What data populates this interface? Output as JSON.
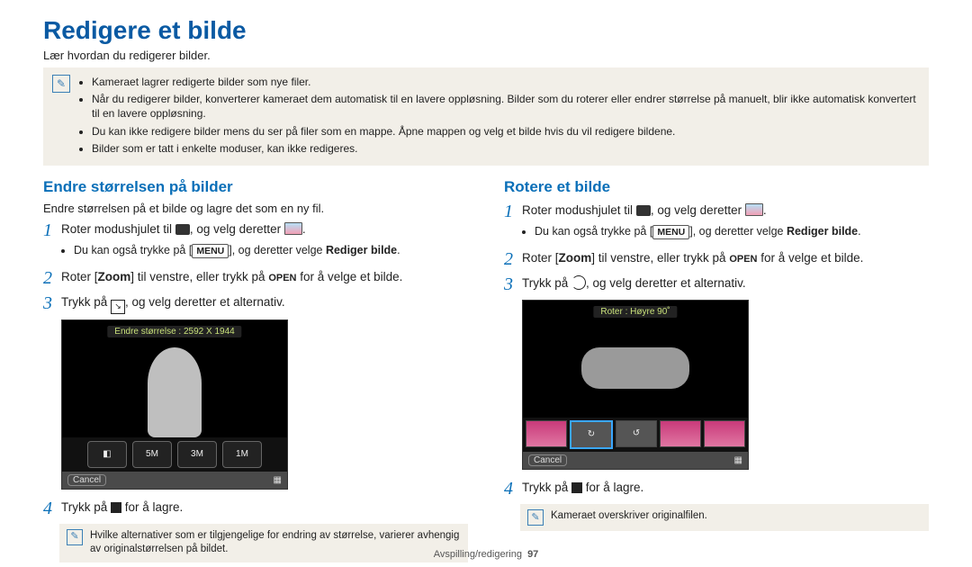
{
  "title": "Redigere et bilde",
  "subtitle": "Lær hvordan du redigerer bilder.",
  "topnotes": [
    "Kameraet lagrer redigerte bilder som nye filer.",
    "Når du redigerer bilder, konverterer kameraet dem automatisk til en lavere oppløsning. Bilder som du roterer eller endrer størrelse på manuelt, blir ikke automatisk konvertert til en lavere oppløsning.",
    "Du kan ikke redigere bilder mens du ser på filer som en mappe. Åpne mappen og velg et bilde hvis du vil redigere bildene.",
    "Bilder som er tatt i enkelte moduser, kan ikke redigeres."
  ],
  "left": {
    "heading": "Endre størrelsen på bilder",
    "intro": "Endre størrelsen på et bilde og lagre det som en ny fil.",
    "step1_a": "Roter modushjulet til ",
    "step1_b": ", og velg deretter ",
    "step1_c": ".",
    "sub1_a": "Du kan også trykke på [",
    "sub1_b": "], og deretter velge ",
    "sub1_bold": "Rediger bilde",
    "step2_a": "Roter [",
    "step2_zoom": "Zoom",
    "step2_b": "] til venstre, eller trykk på ",
    "step2_open": "OPEN",
    "step2_c": " for å velge et bilde.",
    "step3_a": "Trykk på ",
    "step3_b": ", og velg deretter et alternativ.",
    "screenshot_label": "Endre størrelse : 2592 X 1944",
    "screenshot_cancel": "Cancel",
    "thumb_5m": "5M",
    "thumb_3m": "3M",
    "thumb_1m": "1M",
    "step4_a": "Trykk på ",
    "step4_b": " for å lagre.",
    "note2": "Hvilke alternativer som er tilgjengelige for endring av størrelse, varierer avhengig av originalstørrelsen på bildet."
  },
  "right": {
    "heading": "Rotere et bilde",
    "step1_a": "Roter modushjulet til ",
    "step1_b": ", og velg deretter ",
    "step1_c": ".",
    "sub1_a": "Du kan også trykke på [",
    "sub1_b": "], og deretter velge ",
    "sub1_bold": "Rediger bilde",
    "step2_a": "Roter [",
    "step2_zoom": "Zoom",
    "step2_b": "] til venstre, eller trykk på ",
    "step2_open": "OPEN",
    "step2_c": " for å velge et bilde.",
    "step3_a": "Trykk på ",
    "step3_b": ", og velg deretter et alternativ.",
    "screenshot_label": "Roter : Høyre 90˚",
    "screenshot_cancel": "Cancel",
    "step4_a": "Trykk på ",
    "step4_b": " for å lagre.",
    "note2": "Kameraet overskriver originalfilen."
  },
  "footer_section": "Avspilling/redigering",
  "footer_page": "97",
  "labels": {
    "menu": "MENU"
  }
}
